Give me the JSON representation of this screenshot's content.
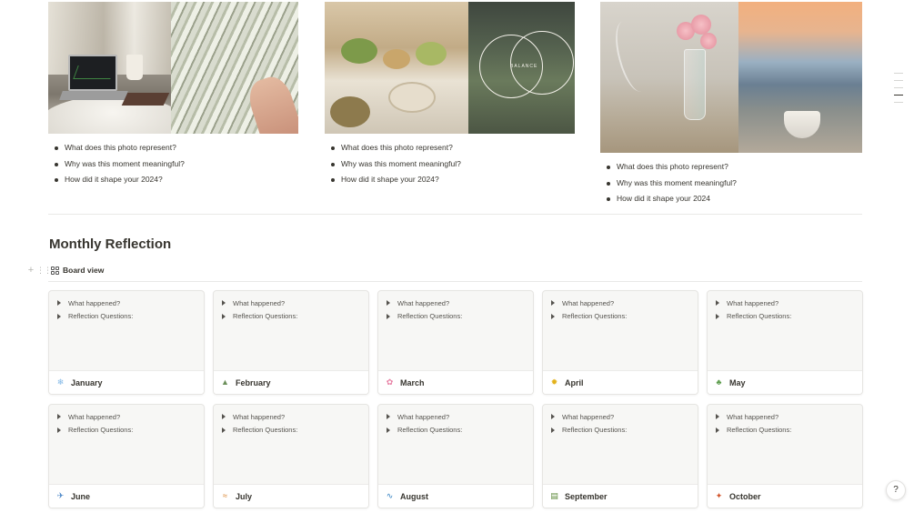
{
  "gallery": [
    {
      "questions": [
        "What does this photo represent?",
        "Why was this moment meaningful?",
        "How did it shape your 2024?"
      ],
      "image": "laptop-and-money-photo"
    },
    {
      "questions": [
        "What does this photo represent?",
        "Why was this moment meaningful?",
        "How did it shape your 2024?"
      ],
      "image": "dinner-table-and-balance-photo",
      "overlay_text": "BALANCE"
    },
    {
      "questions": [
        "What does this photo represent?",
        "Why was this moment meaningful?",
        "How did it shape your 2024"
      ],
      "image": "flowers-and-sea-photo"
    }
  ],
  "section": {
    "title": "Monthly Reflection",
    "view_label": "Board view"
  },
  "card_toggles": [
    "What happened?",
    "Reflection Questions:"
  ],
  "months": [
    {
      "name": "January",
      "icon": "snowflake-icon",
      "glyph": "❄",
      "color": "#7fb6e6"
    },
    {
      "name": "February",
      "icon": "mountain-icon",
      "glyph": "▲",
      "color": "#6b8f5a"
    },
    {
      "name": "March",
      "icon": "blossom-icon",
      "glyph": "✿",
      "color": "#e87fa3"
    },
    {
      "name": "April",
      "icon": "sunflower-icon",
      "glyph": "✹",
      "color": "#e3b21b"
    },
    {
      "name": "May",
      "icon": "potted-plant-icon",
      "glyph": "♣",
      "color": "#5a9b4a"
    },
    {
      "name": "June",
      "icon": "airplane-icon",
      "glyph": "✈",
      "color": "#4a86c7"
    },
    {
      "name": "July",
      "icon": "surfer-icon",
      "glyph": "≈",
      "color": "#d9822b"
    },
    {
      "name": "August",
      "icon": "wave-icon",
      "glyph": "∿",
      "color": "#2f7fc1"
    },
    {
      "name": "September",
      "icon": "books-icon",
      "glyph": "▤",
      "color": "#5c8a3a"
    },
    {
      "name": "October",
      "icon": "maple-leaf-icon",
      "glyph": "✦",
      "color": "#d2542b"
    }
  ],
  "help": {
    "label": "?"
  }
}
